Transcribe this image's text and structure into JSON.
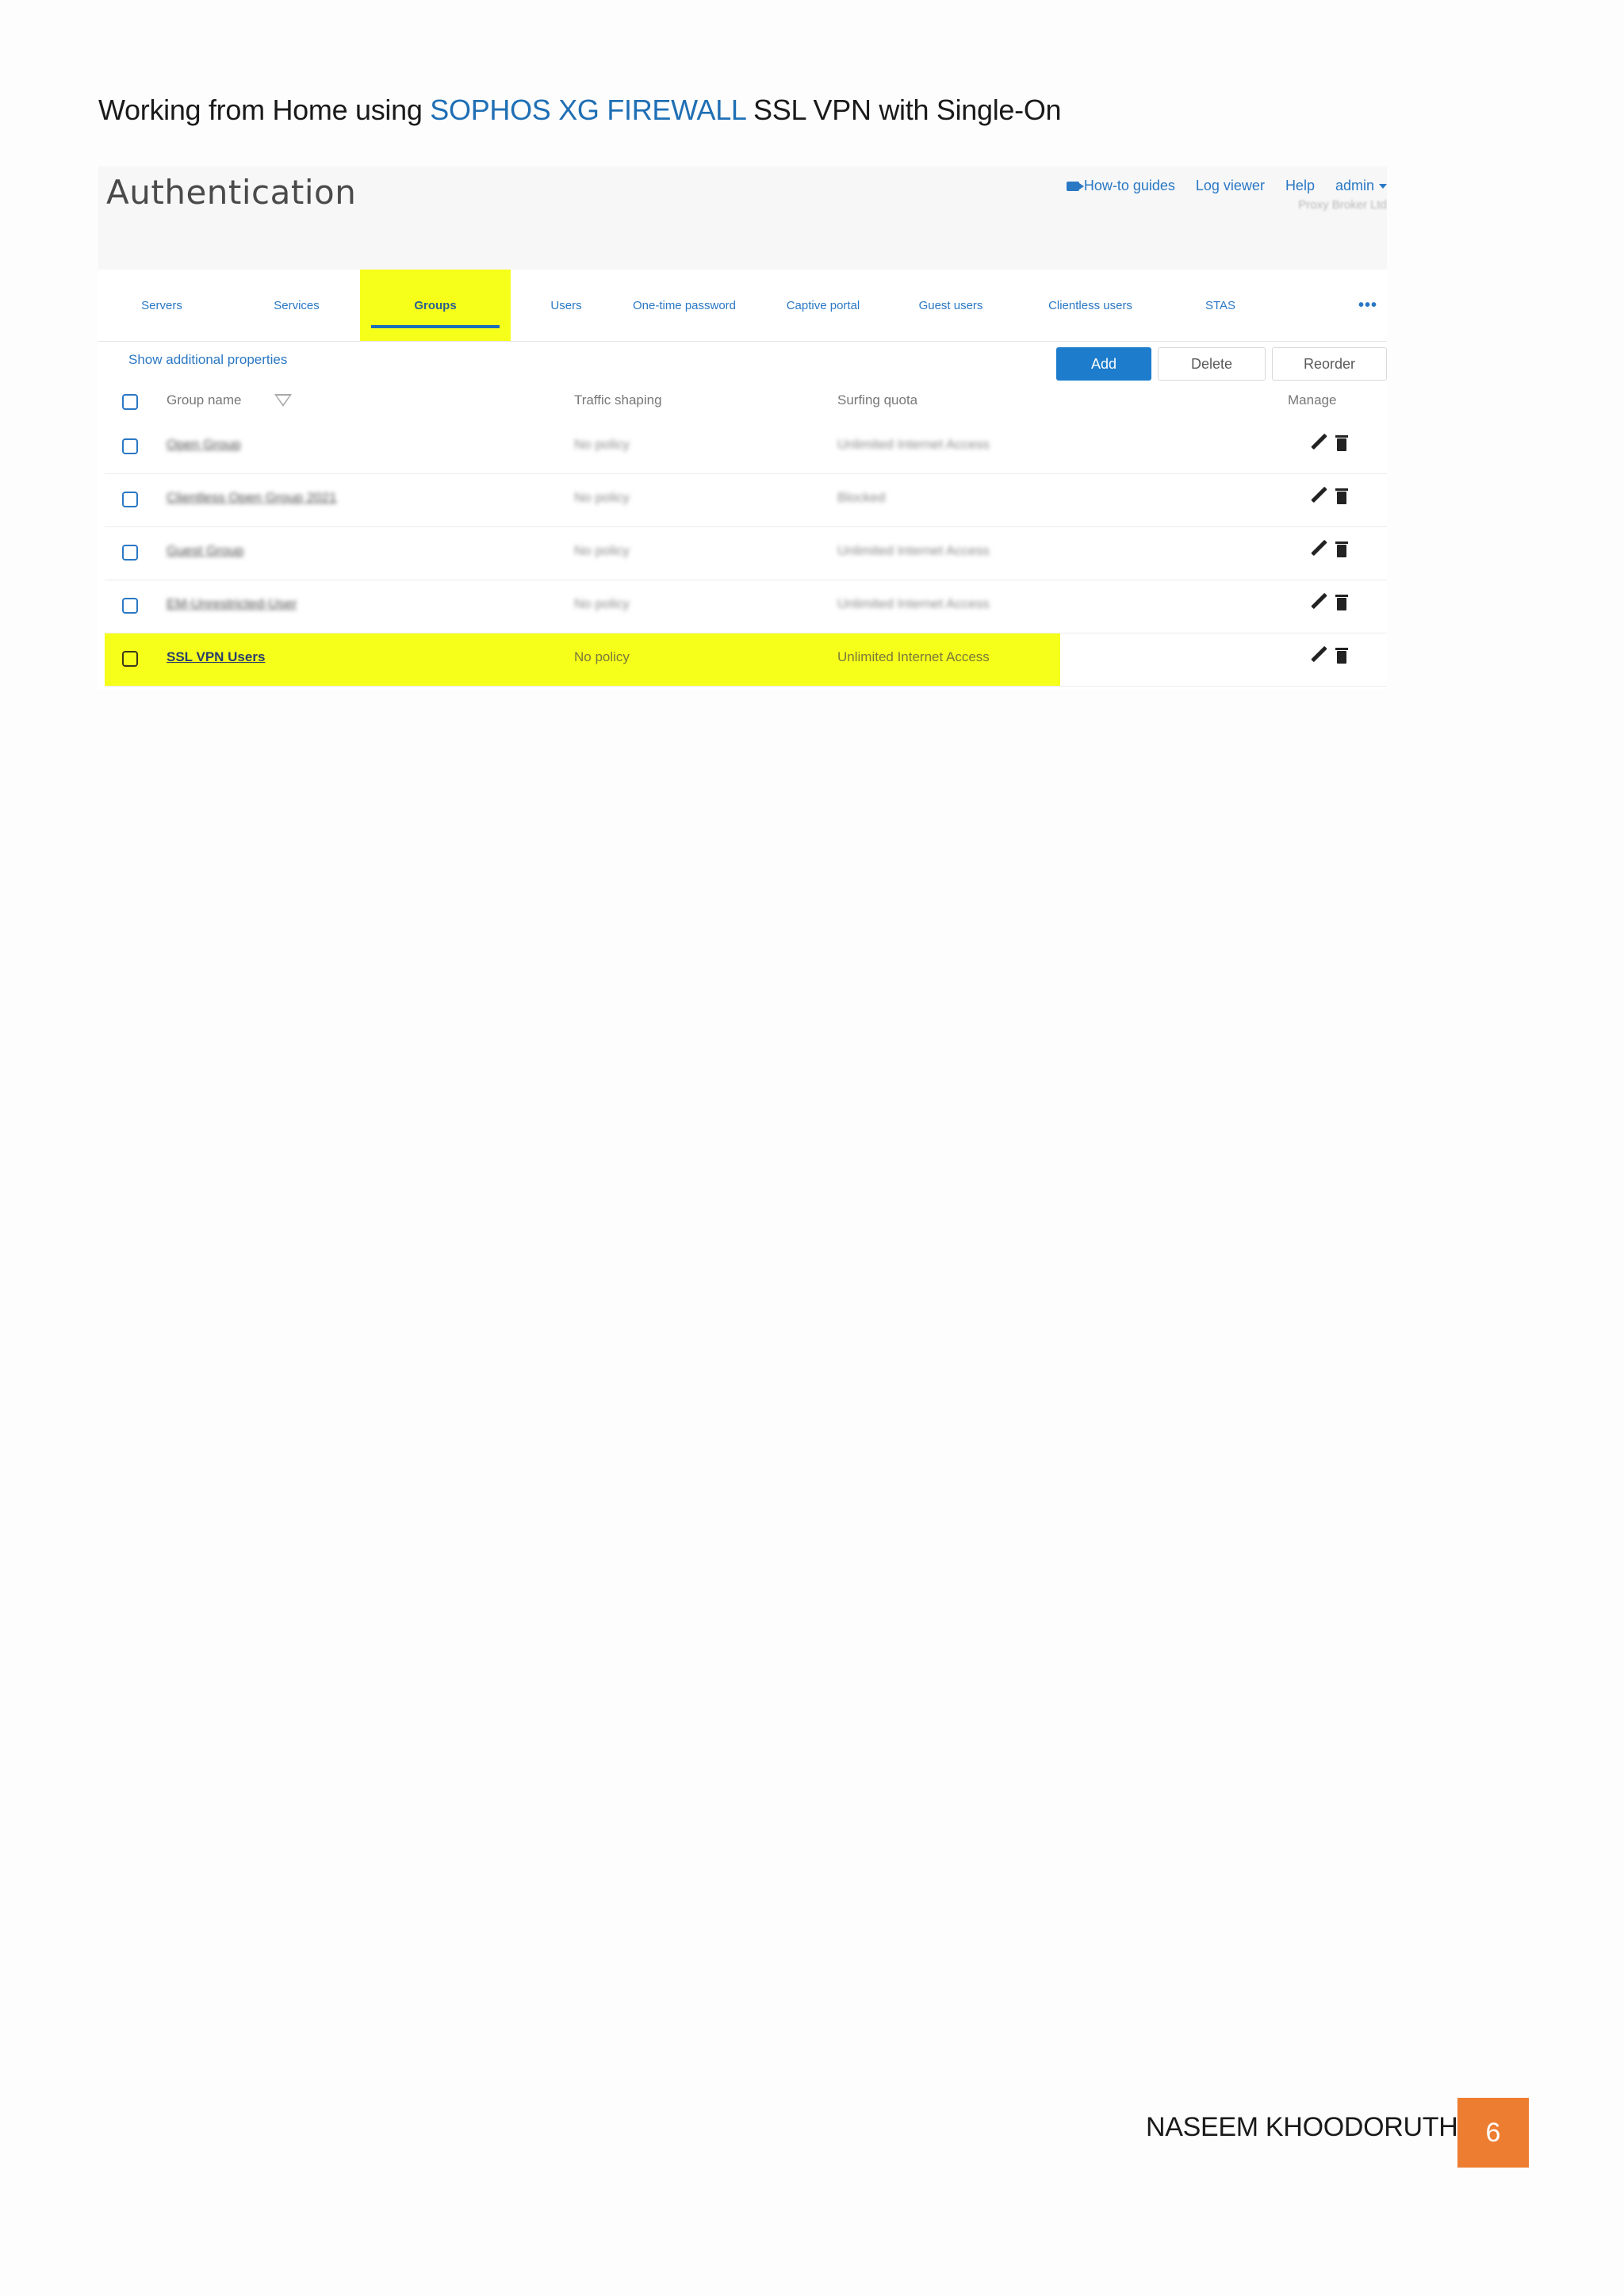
{
  "document": {
    "heading_prefix": "Working from Home using ",
    "heading_highlight": "SOPHOS XG FIREWALL",
    "heading_suffix": " SSL VPN with Single-On",
    "footer_author": "NASEEM KHOODORUTH",
    "page_number": "6",
    "highlight_color": "#1f6fb5",
    "badge_color": "#ed7d31"
  },
  "screenshot": {
    "page_title": "Authentication",
    "top_links": {
      "guides": "How-to guides",
      "log_viewer": "Log viewer",
      "help": "Help",
      "user": "admin",
      "org": "Proxy Broker Ltd"
    },
    "tabs": [
      "Servers",
      "Services",
      "Groups",
      "Users",
      "One-time password",
      "Captive portal",
      "Guest users",
      "Clientless users",
      "STAS"
    ],
    "active_tab": "Groups",
    "more": "•••",
    "show_properties": "Show additional properties",
    "buttons": {
      "add": "Add",
      "delete": "Delete",
      "reorder": "Reorder"
    },
    "columns": {
      "name": "Group name",
      "traffic": "Traffic shaping",
      "quota": "Surfing quota",
      "manage": "Manage"
    },
    "rows": [
      {
        "name": "Open Group",
        "traffic": "No policy",
        "quota": "Unlimited Internet Access",
        "blurred": true
      },
      {
        "name": "Clientless Open Group 2021",
        "traffic": "No policy",
        "quota": "Blocked",
        "blurred": true
      },
      {
        "name": "Guest Group",
        "traffic": "No policy",
        "quota": "Unlimited Internet Access",
        "blurred": true
      },
      {
        "name": "EM-Unrestricted-User",
        "traffic": "No policy",
        "quota": "Unlimited Internet Access",
        "blurred": true
      },
      {
        "name": "SSL VPN Users",
        "traffic": "No policy",
        "quota": "Unlimited Internet Access",
        "blurred": false
      }
    ]
  }
}
